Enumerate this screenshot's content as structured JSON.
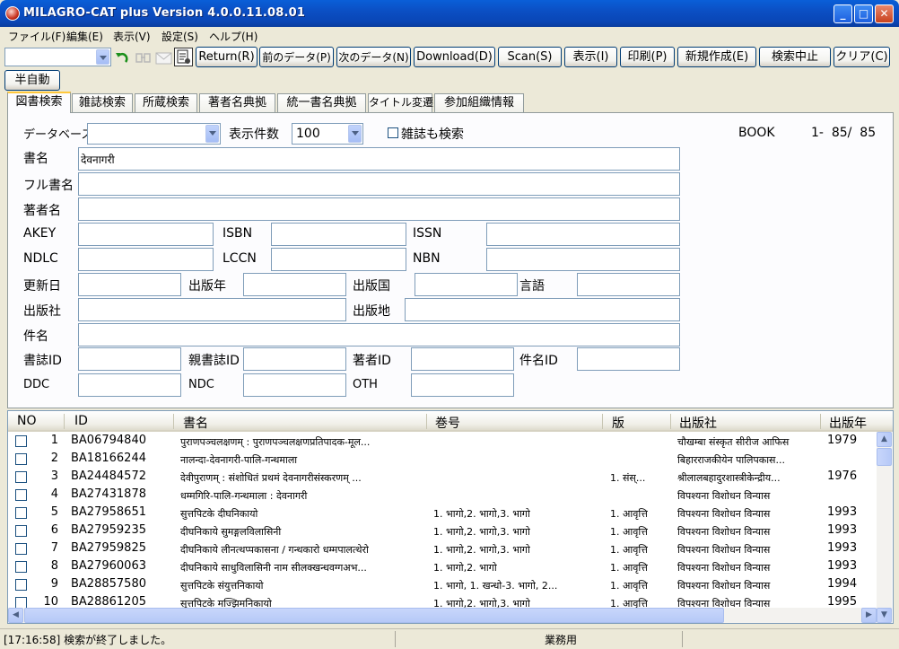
{
  "window": {
    "title": "MILAGRO-CAT plus Version 4.0.0.11.08.01"
  },
  "menu": [
    "ファイル(F)",
    "編集(E)",
    "表示(V)",
    "設定(S)",
    "ヘルプ(H)"
  ],
  "toolbar": {
    "buttons": [
      "Return(R)",
      "前のデータ(P)",
      "次のデータ(N)",
      "Download(D)",
      "Scan(S)",
      "表示(I)",
      "印刷(P)",
      "新規作成(E)",
      "検索中止",
      "クリア(C)"
    ],
    "semi_auto": "半自動"
  },
  "tabs": [
    "図書検索",
    "雑誌検索",
    "所蔵検索",
    "著者名典拠",
    "統一書名典拠",
    "タイトル変遷",
    "参加組織情報"
  ],
  "search": {
    "database_label": "データベース",
    "database_value": "",
    "count_label": "表示件数",
    "count_value": "100",
    "magazine_label": "雑誌も検索",
    "result_type": "BOOK",
    "result_range": "1-  85/  85",
    "title_label": "書名",
    "title_value": "देवनागरी",
    "fulltitle_label": "フル書名",
    "author_label": "著者名",
    "akey_label": "AKEY",
    "isbn_label": "ISBN",
    "issn_label": "ISSN",
    "ndlc_label": "NDLC",
    "lccn_label": "LCCN",
    "nbn_label": "NBN",
    "updated_label": "更新日",
    "pubyear_label": "出版年",
    "pubcountry_label": "出版国",
    "language_label": "言語",
    "publisher_label": "出版社",
    "pubplace_label": "出版地",
    "subject_label": "件名",
    "bibid_label": "書誌ID",
    "parentid_label": "親書誌ID",
    "authorid_label": "著者ID",
    "subjectid_label": "件名ID",
    "ddc_label": "DDC",
    "ndc_label": "NDC",
    "oth_label": "OTH"
  },
  "list": {
    "columns": [
      "NO",
      "ID",
      "書名",
      "巻号",
      "版",
      "出版社",
      "出版年"
    ],
    "rows": [
      {
        "no": "1",
        "id": "BA06794840",
        "title": "पुराणपञ्चलक्षणम् : पुराणपञ्चलक्षणप्रतिपादक-मूल...",
        "vol": "",
        "ed": "",
        "pub": "चौखम्बा संस्कृत सीरीज आफिस",
        "year": "1979"
      },
      {
        "no": "2",
        "id": "BA18166244",
        "title": "नालन्दा-देवनागरी-पालि-गन्थमाला",
        "vol": "",
        "ed": "",
        "pub": "बिहारराजकीयेन पालिपकास...",
        "year": ""
      },
      {
        "no": "3",
        "id": "BA24484572",
        "title": "देवीपुराणम् : संशोधितं प्रथमं देवनागरीसंस्करणम् ...",
        "vol": "",
        "ed": "1. संस्...",
        "pub": "श्रीलालबहादुरशास्त्रीकेन्द्रीय...",
        "year": "1976"
      },
      {
        "no": "4",
        "id": "BA27431878",
        "title": "धम्मगिरि-पालि-गन्थमाला : देवनागरी",
        "vol": "",
        "ed": "",
        "pub": "विपश्यना विशोधन विन्यास",
        "year": ""
      },
      {
        "no": "5",
        "id": "BA27958651",
        "title": "सुत्तपिटके दीघनिकायो",
        "vol": "1. भागो,2. भागो,3. भागो",
        "ed": "1. आवृत्ति",
        "pub": "विपश्यना विशोधन विन्यास",
        "year": "1993"
      },
      {
        "no": "6",
        "id": "BA27959235",
        "title": "दीघनिकाये सुमङ्गलविलासिनी",
        "vol": "1. भागो,2. भागो,3. भागो",
        "ed": "1. आवृत्ति",
        "pub": "विपश्यना विशोधन विन्यास",
        "year": "1993"
      },
      {
        "no": "7",
        "id": "BA27959825",
        "title": "दीघनिकाये लीनत्थप्पकासना / गन्थकारो धम्मपालत्थेरो",
        "vol": "1. भागो,2. भागो,3. भागो",
        "ed": "1. आवृत्ति",
        "pub": "विपश्यना विशोधन विन्यास",
        "year": "1993"
      },
      {
        "no": "8",
        "id": "BA27960063",
        "title": "दीघनिकाये साधुविलासिनी नाम सीलक्खन्धवग्गअभ...",
        "vol": "1. भागो,2. भागो",
        "ed": "1. आवृत्ति",
        "pub": "विपश्यना विशोधन विन्यास",
        "year": "1993"
      },
      {
        "no": "9",
        "id": "BA28857580",
        "title": "सुत्तपिटके संयुत्तनिकायो",
        "vol": "1. भागो, 1. खन्धो-3. भागो, 2...",
        "ed": "1. आवृत्ति",
        "pub": "विपश्यना विशोधन विन्यास",
        "year": "1994"
      },
      {
        "no": "10",
        "id": "BA28861205",
        "title": "सुत्तपिटके मज्झिमनिकायो",
        "vol": "1. भागो,2. भागो,3. भागो",
        "ed": "1. आवृत्ति",
        "pub": "विपश्यना विशोधन विन्यास",
        "year": "1995"
      }
    ]
  },
  "status": {
    "message": "[17:16:58] 検索が終了しました。",
    "mode": "業務用"
  }
}
